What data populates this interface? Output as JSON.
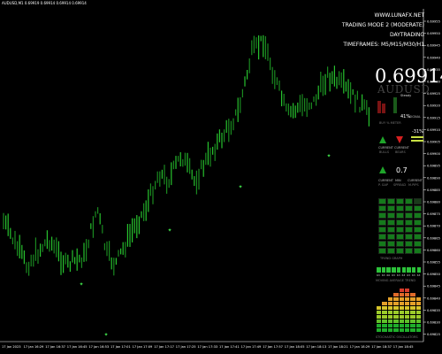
{
  "header": {
    "symbol_line": "AUDUSD,M1 0.69919 0.69914 0.69914 0.69914"
  },
  "info_panel": {
    "lines": [
      "WWW.LUNAFX.NET",
      "TRADING MODE 2 (MODERATE)",
      "DAYTRADING",
      "TIMEFRAMES: M5/M15/M30/H1"
    ]
  },
  "price_display": {
    "price": "0.69914",
    "pair": "AUDUSD"
  },
  "status_label": "Steady",
  "meter": {
    "pct": "41%",
    "signal": "SIGNAL",
    "meter_label": "BUY % METER",
    "change": "-31%"
  },
  "current_row1": {
    "left_title": "CURRENT",
    "left_sub": "BULLS",
    "right_title": "CURRENT",
    "right_sub": "BEARS"
  },
  "current_row2": {
    "left_title": "CURRENT",
    "left_sub": "P. GAP",
    "mid_title": "MIN",
    "mid_sub": "SPREAD",
    "right_title": "CURRENT",
    "right_sub": "M.PIPS",
    "spread_value": "0.7"
  },
  "trend_graph_label": "TREND GRAPH",
  "ma_trend_label": "MOVING AVERAGE TREND",
  "ma_values": [
    "63",
    "63",
    "66",
    "63",
    "63",
    "63",
    "63",
    "63",
    "63"
  ],
  "stochastic_label": "STOCHASTIC OSCILLATORS",
  "colors": {
    "bull_bar": "#27c22e",
    "bear_bar": "#27c22e",
    "buy": "#1fa52a",
    "sell": "#d62020"
  },
  "price_axis": [
    "0.69955",
    "0.69950",
    "0.69945",
    "0.69940",
    "0.69935",
    "0.69930",
    "0.69925",
    "0.69920",
    "0.69915",
    "0.69910",
    "0.69905",
    "0.69900",
    "0.69895",
    "0.69890",
    "0.69885",
    "0.69880",
    "0.69875",
    "0.69870",
    "0.69865",
    "0.69860",
    "0.69855",
    "0.69850",
    "0.69845",
    "0.69840",
    "0.69835",
    "0.69830",
    "0.69825"
  ],
  "time_axis": [
    "17 Jan 2023",
    "17 Jan 16:29",
    "17 Jan 16:37",
    "17 Jan 16:45",
    "17 Jan 16:53",
    "17 Jan 17:01",
    "17 Jan 17:09",
    "17 Jan 17:17",
    "17 Jan 17:25",
    "17 Jan 17:33",
    "17 Jan 17:41",
    "17 Jan 17:49",
    "17 Jan 17:57",
    "17 Jan 18:05",
    "17 Jan 18:13",
    "17 Jan 18:21",
    "17 Jan 18:29",
    "17 Jan 18:37",
    "17 Jan 18:45"
  ]
}
